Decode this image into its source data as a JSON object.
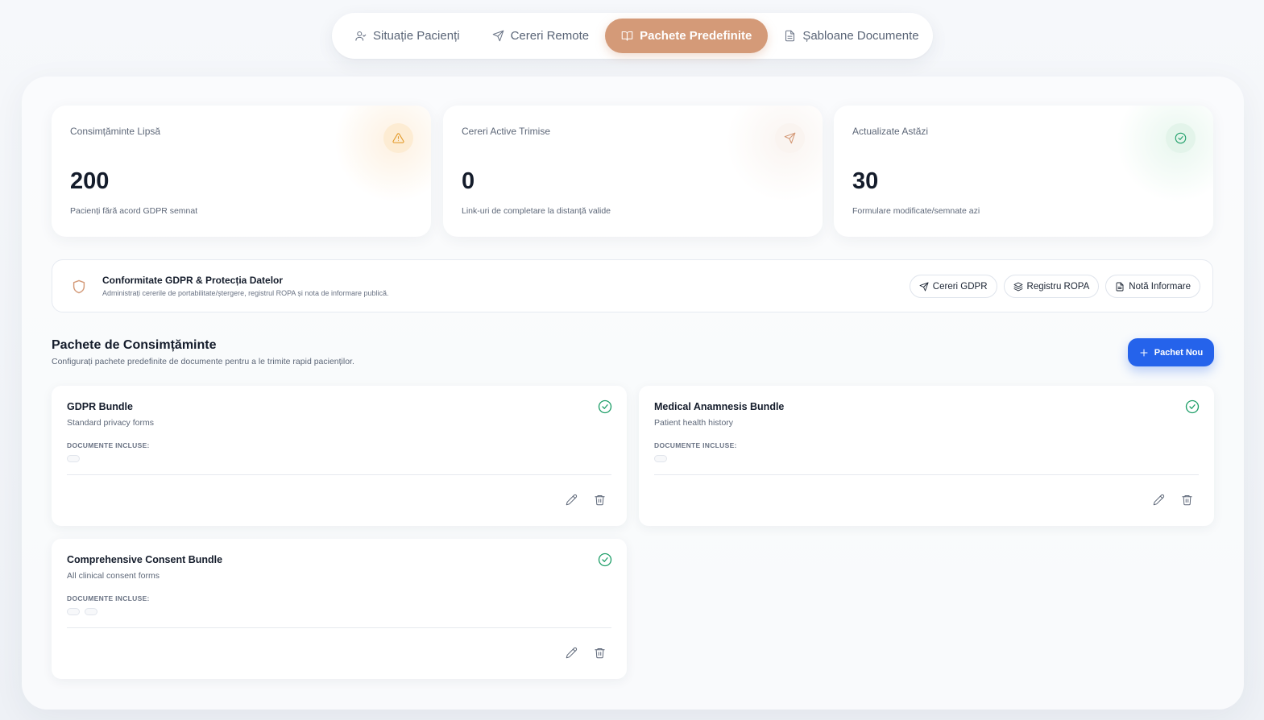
{
  "tabs": [
    {
      "label": "Situație Pacienți",
      "icon": "user-icon",
      "active": false
    },
    {
      "label": "Cereri Remote",
      "icon": "send-icon",
      "active": false
    },
    {
      "label": "Pachete Predefinite",
      "icon": "book-open-icon",
      "active": true
    },
    {
      "label": "Șabloane Documente",
      "icon": "file-text-icon",
      "active": false
    }
  ],
  "stats": [
    {
      "label": "Consimțăminte Lipsă",
      "value": "200",
      "sub": "Pacienți fără acord GDPR semnat",
      "icon": "alert-triangle-icon",
      "color": "#e39a2a"
    },
    {
      "label": "Cereri Active Trimise",
      "value": "0",
      "sub": "Link-uri de completare la distanță valide",
      "icon": "send-icon",
      "color": "#d49a78"
    },
    {
      "label": "Actualizate Astăzi",
      "value": "30",
      "sub": "Formulare modificate/semnate azi",
      "icon": "check-circle-icon",
      "color": "#22a06b"
    }
  ],
  "gdpr": {
    "title": "Conformitate GDPR & Protecția Datelor",
    "subtitle": "Administrați cererile de portabilitate/ștergere, registrul ROPA și nota de informare publică.",
    "actions": [
      {
        "label": "Cereri GDPR",
        "icon": "send-icon"
      },
      {
        "label": "Registru ROPA",
        "icon": "layers-icon"
      },
      {
        "label": "Notă Informare",
        "icon": "file-text-icon"
      }
    ]
  },
  "section": {
    "title": "Pachete de Consimțăminte",
    "subtitle": "Configurați pachete predefinite de documente pentru a le trimite rapid pacienților.",
    "new_button": "Pachet Nou"
  },
  "bundles": [
    {
      "title": "GDPR Bundle",
      "subtitle": "Standard privacy forms",
      "docs_label": "DOCUMENTE INCLUSE:",
      "chips": 1
    },
    {
      "title": "Medical Anamnesis Bundle",
      "subtitle": "Patient health history",
      "docs_label": "DOCUMENTE INCLUSE:",
      "chips": 1
    },
    {
      "title": "Comprehensive Consent Bundle",
      "subtitle": "All clinical consent forms",
      "docs_label": "DOCUMENTE INCLUSE:",
      "chips": 2
    }
  ],
  "colors": {
    "accent": "#d49a78",
    "primary": "#2563eb",
    "success": "#22a06b",
    "warning": "#e39a2a"
  }
}
